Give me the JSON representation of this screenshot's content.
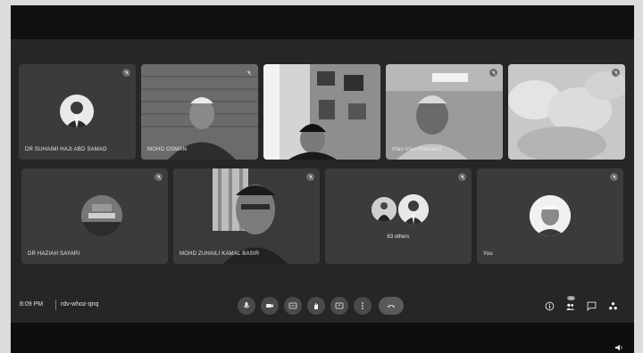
{
  "meeting": {
    "time": "8:09 PM",
    "code": "rdv-whoz-qnq"
  },
  "participants": [
    {
      "name": "DR SUHAIMI HAJI ABD SAMAD",
      "kind": "avatar"
    },
    {
      "name": "MOHD OSMAN",
      "kind": "video"
    },
    {
      "name": "",
      "kind": "video"
    },
    {
      "name": "Irfan Irfan Rasheed",
      "kind": "video"
    },
    {
      "name": "",
      "kind": "video"
    },
    {
      "name": "DR HAZIAH SAYARI",
      "kind": "avatar"
    },
    {
      "name": "MOHD ZUHAILI KAMAL BASIR",
      "kind": "video"
    },
    {
      "name": "",
      "kind": "group"
    },
    {
      "name": "You",
      "kind": "avatar"
    }
  ],
  "others_label": "63 others",
  "others_badge": "63",
  "controls": [
    {
      "icon": "mic-icon"
    },
    {
      "icon": "camera-icon"
    },
    {
      "icon": "captions-icon"
    },
    {
      "icon": "raise-hand-icon"
    },
    {
      "icon": "present-icon"
    },
    {
      "icon": "more-options-icon"
    },
    {
      "icon": "hangup-icon"
    }
  ],
  "right_controls": [
    {
      "icon": "info-icon"
    },
    {
      "icon": "people-icon"
    },
    {
      "icon": "chat-icon"
    },
    {
      "icon": "activities-icon"
    }
  ],
  "colors": {
    "background": "#1c1c1c",
    "tile": "#3b3b3b",
    "control": "#4a4a4a"
  }
}
